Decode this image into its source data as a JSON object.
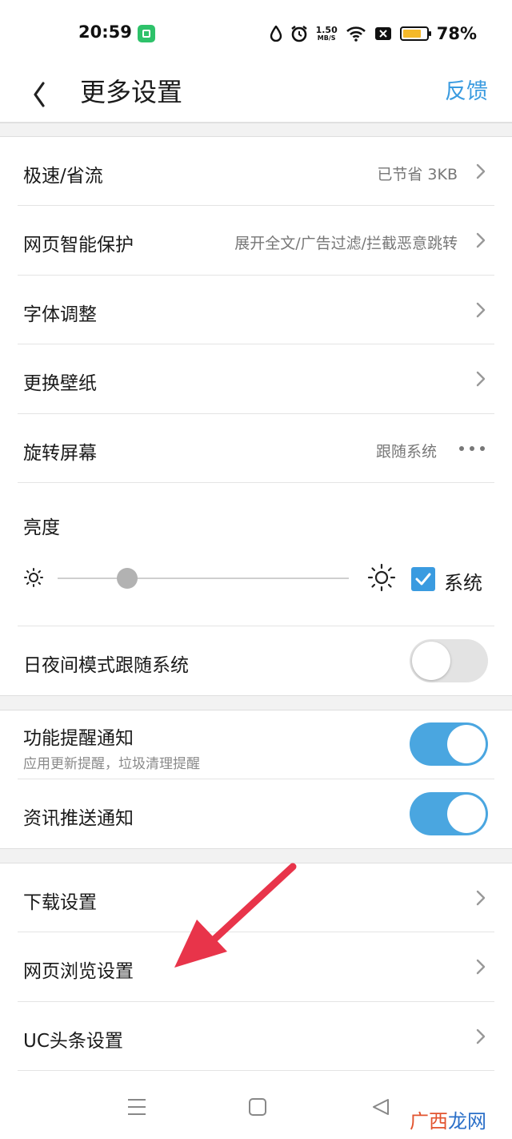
{
  "status_bar": {
    "time": "20:59",
    "speed_value": "1.50",
    "speed_unit": "MB/S",
    "battery_percent": "78%",
    "battery_level": 0.78,
    "icons": [
      "app-notification-icon",
      "drop-icon",
      "alarm-icon",
      "wifi-icon",
      "close-box-icon",
      "battery-icon"
    ]
  },
  "header": {
    "title": "更多设置",
    "feedback": "反馈"
  },
  "section1": {
    "rows": [
      {
        "label": "极速/省流",
        "value": "已节省 3KB"
      },
      {
        "label": "网页智能保护",
        "value": "展开全文/广告过滤/拦截恶意跳转"
      },
      {
        "label": "字体调整",
        "value": ""
      },
      {
        "label": "更换壁纸",
        "value": ""
      },
      {
        "label": "旋转屏幕",
        "value": "跟随系统"
      }
    ],
    "brightness": {
      "label": "亮度",
      "level": 0.24,
      "system_checked": true,
      "system_label": "系统"
    },
    "night_mode": {
      "label": "日夜间模式跟随系统",
      "on": false
    }
  },
  "section2": {
    "feature_reminder": {
      "label": "功能提醒通知",
      "sublabel": "应用更新提醒，垃圾清理提醒",
      "on": true
    },
    "news_push": {
      "label": "资讯推送通知",
      "on": true
    }
  },
  "section3": {
    "rows": [
      {
        "label": "下载设置"
      },
      {
        "label": "网页浏览设置"
      },
      {
        "label": "UC头条设置"
      }
    ]
  },
  "annotation": {
    "color": "#e8344a"
  },
  "watermark": {
    "part1": "广西",
    "part2": "龙网"
  },
  "colors": {
    "accent": "#3a9be0",
    "toggle_on": "#4aa6e0",
    "checkbox": "#3a9be0"
  }
}
